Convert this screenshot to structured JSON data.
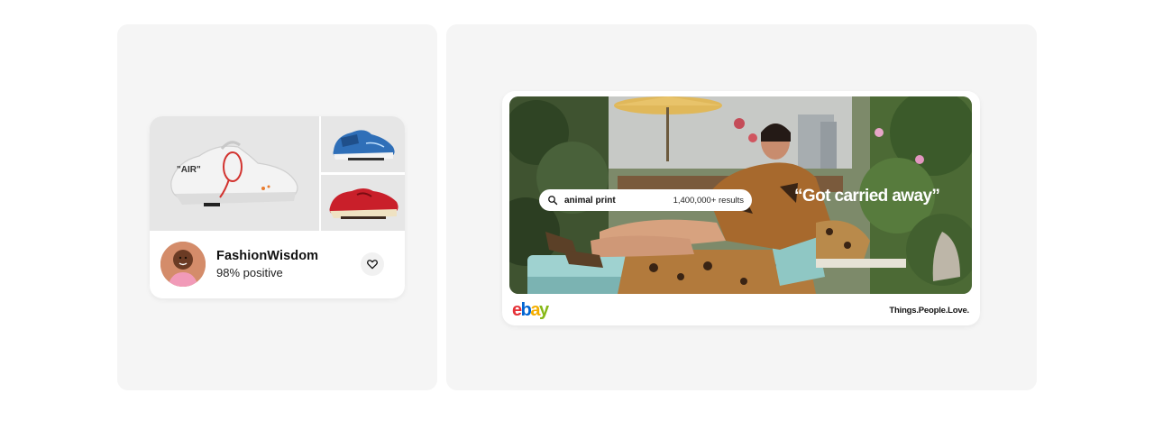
{
  "seller_card": {
    "name": "FashionWisdom",
    "rating": "98% positive",
    "shoes": {
      "main": "white-sneaker",
      "side_top": "blue-sneaker",
      "side_bottom": "red-sneaker"
    },
    "main_shoe_text": "\"AIR\"",
    "heart_icon": "heart-outline-icon"
  },
  "ad": {
    "search_query": "animal print",
    "search_results": "1,400,000+ results",
    "tagline": "“Got carried away”",
    "logo_letters": [
      "e",
      "b",
      "a",
      "y"
    ],
    "logo_colors": [
      "#e53238",
      "#0064d2",
      "#f5af02",
      "#86b817"
    ],
    "slogan": "Things.People.Love."
  }
}
